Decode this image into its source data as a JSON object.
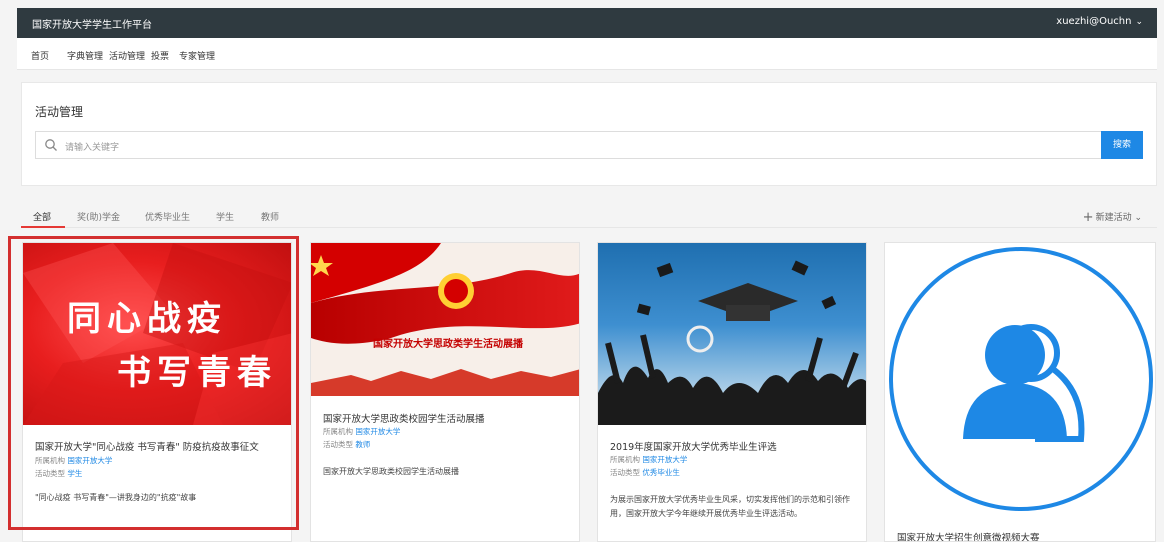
{
  "topbar": {
    "brand": "国家开放大学学生工作平台",
    "user": "xuezhi@Ouchn"
  },
  "nav": [
    "首页",
    "字典管理",
    "活动管理",
    "投票",
    "专家管理"
  ],
  "panel": {
    "title": "活动管理",
    "search_placeholder": "请输入关键字",
    "search_button": "搜索"
  },
  "tabs": [
    "全部",
    "奖(助)学金",
    "优秀毕业生",
    "学生",
    "教师"
  ],
  "new_activity": "新建活动",
  "cards": [
    {
      "image_text_1": "同心战疫",
      "image_text_2": "书写青春",
      "title": "国家开放大学\"同心战疫 书写青春\" 防疫抗疫故事征文",
      "org_label": "所属机构",
      "org": "国家开放大学",
      "type_label": "活动类型",
      "type": "学生",
      "desc": "\"同心战疫 书写青春\"—讲我身边的\"抗疫\"故事"
    },
    {
      "image_text": "国家开放大学思政类学生活动展播",
      "title": "国家开放大学思政类校园学生活动展播",
      "org_label": "所属机构",
      "org": "国家开放大学",
      "type_label": "活动类型",
      "type": "教师",
      "desc": "国家开放大学思政类校园学生活动展播"
    },
    {
      "title": "2019年度国家开放大学优秀毕业生评选",
      "org_label": "所属机构",
      "org": "国家开放大学",
      "type_label": "活动类型",
      "type": "优秀毕业生",
      "desc": "为展示国家开放大学优秀毕业生风采，切实发挥他们的示范和引领作用，国家开放大学今年继续开展优秀毕业生评选活动。"
    },
    {
      "title": "国家开放大学招生创意微视频大赛"
    }
  ],
  "colors": {
    "topbar": "#2f3a40",
    "accent": "#1e88e5",
    "highlight": "#d32f2f"
  }
}
